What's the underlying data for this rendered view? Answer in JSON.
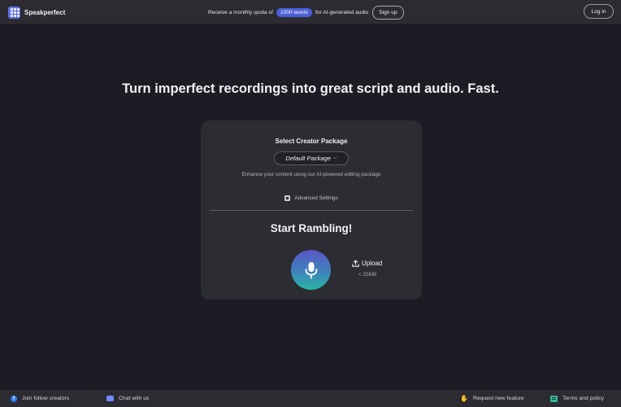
{
  "header": {
    "brand": "Speakperfect",
    "promo_prefix": "Receive a monthly quota of",
    "promo_highlight": "1000 words",
    "promo_suffix": "for AI-generated audio",
    "signup_label": "Sign up",
    "login_label": "Log in"
  },
  "hero": {
    "title": "Turn imperfect recordings into great script and audio. Fast."
  },
  "card": {
    "title": "Select Creator Package",
    "package_value": "Default Package",
    "description": "Enhance your content using our AI-powered editing package",
    "advanced_label": "Advanced Settings",
    "ramble_title": "Start Rambling!",
    "upload_label": "Upload",
    "upload_limit": "< 25MB"
  },
  "footer": {
    "join": "Join follow creators",
    "chat": "Chat with us",
    "request": "Request new feature",
    "terms": "Terms and policy"
  },
  "colors": {
    "background": "#1d1c24",
    "bar": "#2b2b31",
    "card": "#2c2c33",
    "accent": "#4a5fd8",
    "mic_gradient_top": "#5a56c7",
    "mic_gradient_bottom": "#2ab6a6"
  },
  "icons": [
    "grid-logo-icon",
    "chevron-down-icon",
    "settings-icon",
    "microphone-icon",
    "upload-icon",
    "facebook-icon",
    "discord-icon",
    "waving-hand-icon",
    "terms-icon"
  ]
}
